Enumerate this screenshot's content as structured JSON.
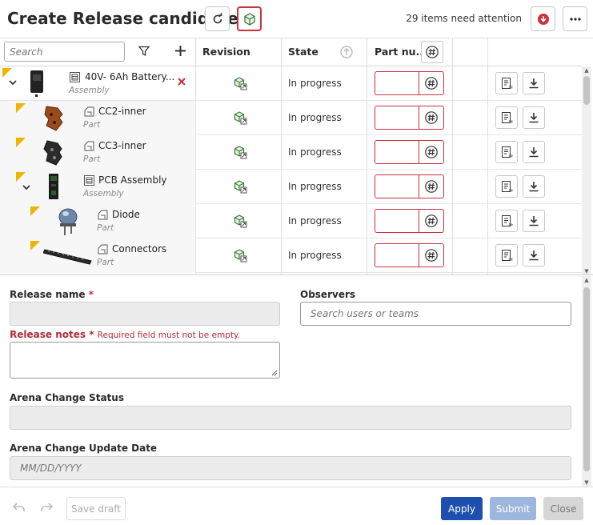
{
  "header": {
    "title": "Create Release candidate",
    "attention": "29 items need attention"
  },
  "table": {
    "search_placeholder": "Search",
    "columns": {
      "revision": "Revision",
      "state": "State",
      "part_number": "Part nu..."
    },
    "rows": [
      {
        "name": "40V- 6Ah Battery...",
        "type": "Assembly",
        "state": "In progress"
      },
      {
        "name": "CC2-inner",
        "type": "Part",
        "state": "In progress"
      },
      {
        "name": "CC3-inner",
        "type": "Part",
        "state": "In progress"
      },
      {
        "name": "PCB Assembly",
        "type": "Assembly",
        "state": "In progress"
      },
      {
        "name": "Diode",
        "type": "Part",
        "state": "In progress"
      },
      {
        "name": "Connectors",
        "type": "Part",
        "state": "In progress"
      }
    ]
  },
  "form": {
    "release_name_label": "Release name",
    "release_notes_label": "Release notes",
    "release_notes_error": "Required field must not be empty.",
    "observers_label": "Observers",
    "observers_placeholder": "Search users or teams",
    "arena_status_label": "Arena Change Status",
    "arena_date_label": "Arena Change Update Date",
    "arena_date_placeholder": "MM/DD/YYYY",
    "required_mark": "*"
  },
  "footer": {
    "save_draft": "Save draft",
    "apply": "Apply",
    "submit": "Submit",
    "close": "Close"
  },
  "colors": {
    "accent_red": "#c8323c",
    "apply_blue": "#1f4fae",
    "submit_blue": "#9db6de",
    "warning_yellow": "#f0b400"
  }
}
